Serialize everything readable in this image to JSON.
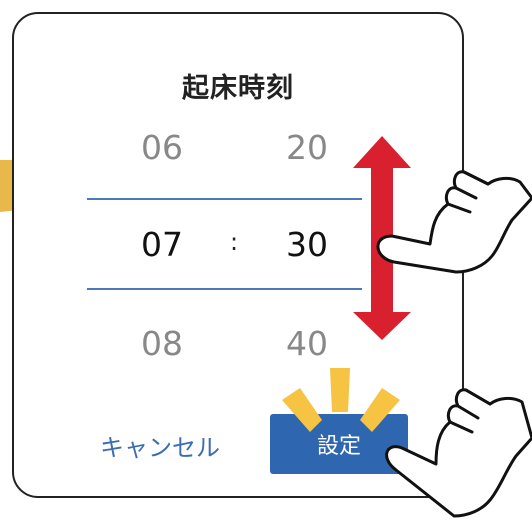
{
  "dialog": {
    "title": "起床時刻",
    "picker": {
      "hours": {
        "prev": "06",
        "selected": "07",
        "next": "08"
      },
      "minutes": {
        "prev": "20",
        "selected": "30",
        "next": "40"
      },
      "separator": ":"
    },
    "cancel_label": "キャンセル",
    "set_label": "設定"
  },
  "colors": {
    "accent_blue": "#2f66b0",
    "selection_line": "#4a78b8",
    "arrow_red": "#d9202e",
    "highlight_yellow": "#f6c343",
    "pointer_yellow": "#e8b84a"
  },
  "icons": [
    "scroll-arrow-icon",
    "pointing-hand-icon",
    "pointing-hand-icon",
    "highlight-burst-icon",
    "pointer-arrow-icon"
  ]
}
